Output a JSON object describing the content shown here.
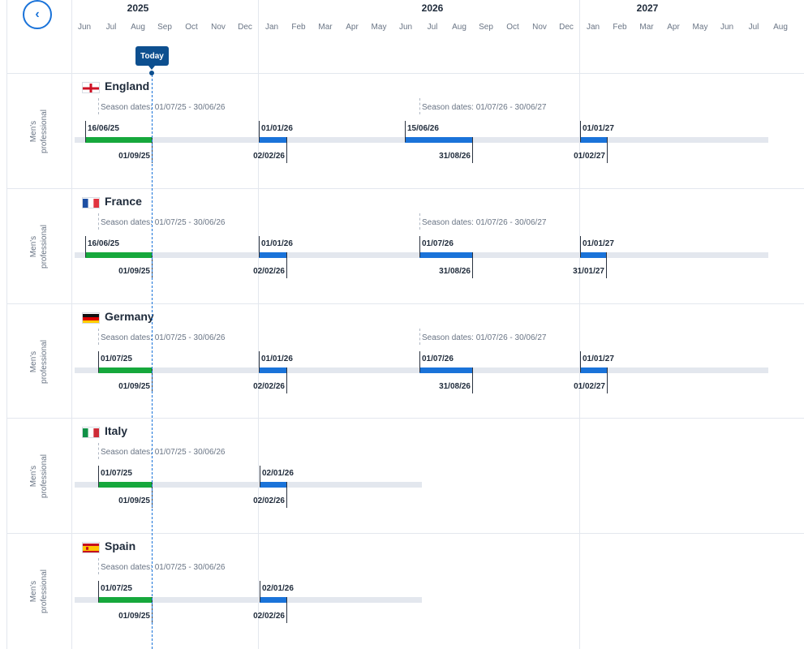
{
  "header": {
    "back_icon": "chevron-left-icon",
    "back_glyph": "‹",
    "years": [
      "2025",
      "2026",
      "2027"
    ],
    "months": [
      "Jun",
      "Jul",
      "Aug",
      "Sep",
      "Oct",
      "Nov",
      "Dec",
      "Jan",
      "Feb",
      "Mar",
      "Apr",
      "May",
      "Jun",
      "Jul",
      "Aug",
      "Sep",
      "Oct",
      "Nov",
      "Dec",
      "Jan",
      "Feb",
      "Mar",
      "Apr",
      "May",
      "Jun",
      "Jul",
      "Aug"
    ],
    "today_label": "Today"
  },
  "colors": {
    "accent": "#1a73d9",
    "today": "#0d4f8f",
    "open_window": "#16a83c",
    "future_window": "#1a73d9",
    "track": "#e3e7ee"
  },
  "rows": [
    {
      "country": "England",
      "flag": "england",
      "category": "Men's professional",
      "seasons": [
        "Season dates: 01/07/25 - 30/06/26",
        "Season dates: 01/07/26 - 30/06/27"
      ],
      "windows": [
        {
          "open": "16/06/25",
          "close": "01/09/25",
          "status": "current"
        },
        {
          "open": "01/01/26",
          "close": "02/02/26",
          "status": "future"
        },
        {
          "open": "15/06/26",
          "close": "31/08/26",
          "status": "future"
        },
        {
          "open": "01/01/27",
          "close": "01/02/27",
          "status": "future"
        }
      ]
    },
    {
      "country": "France",
      "flag": "france",
      "category": "Men's professional",
      "seasons": [
        "Season dates: 01/07/25 - 30/06/26",
        "Season dates: 01/07/26 - 30/06/27"
      ],
      "windows": [
        {
          "open": "16/06/25",
          "close": "01/09/25",
          "status": "current"
        },
        {
          "open": "01/01/26",
          "close": "02/02/26",
          "status": "future"
        },
        {
          "open": "01/07/26",
          "close": "31/08/26",
          "status": "future"
        },
        {
          "open": "01/01/27",
          "close": "31/01/27",
          "status": "future"
        }
      ]
    },
    {
      "country": "Germany",
      "flag": "germany",
      "category": "Men's professional",
      "seasons": [
        "Season dates: 01/07/25 - 30/06/26",
        "Season dates: 01/07/26 - 30/06/27"
      ],
      "windows": [
        {
          "open": "01/07/25",
          "close": "01/09/25",
          "status": "current"
        },
        {
          "open": "01/01/26",
          "close": "02/02/26",
          "status": "future"
        },
        {
          "open": "01/07/26",
          "close": "31/08/26",
          "status": "future"
        },
        {
          "open": "01/01/27",
          "close": "01/02/27",
          "status": "future"
        }
      ]
    },
    {
      "country": "Italy",
      "flag": "italy",
      "category": "Men's professional",
      "seasons": [
        "Season dates: 01/07/25 - 30/06/26"
      ],
      "windows": [
        {
          "open": "01/07/25",
          "close": "01/09/25",
          "status": "current"
        },
        {
          "open": "02/01/26",
          "close": "02/02/26",
          "status": "future"
        }
      ]
    },
    {
      "country": "Spain",
      "flag": "spain",
      "category": "Men's professional",
      "seasons": [
        "Season dates: 01/07/25 - 30/06/26"
      ],
      "windows": [
        {
          "open": "01/07/25",
          "close": "01/09/25",
          "status": "current"
        },
        {
          "open": "02/01/26",
          "close": "02/02/26",
          "status": "future"
        }
      ]
    }
  ]
}
